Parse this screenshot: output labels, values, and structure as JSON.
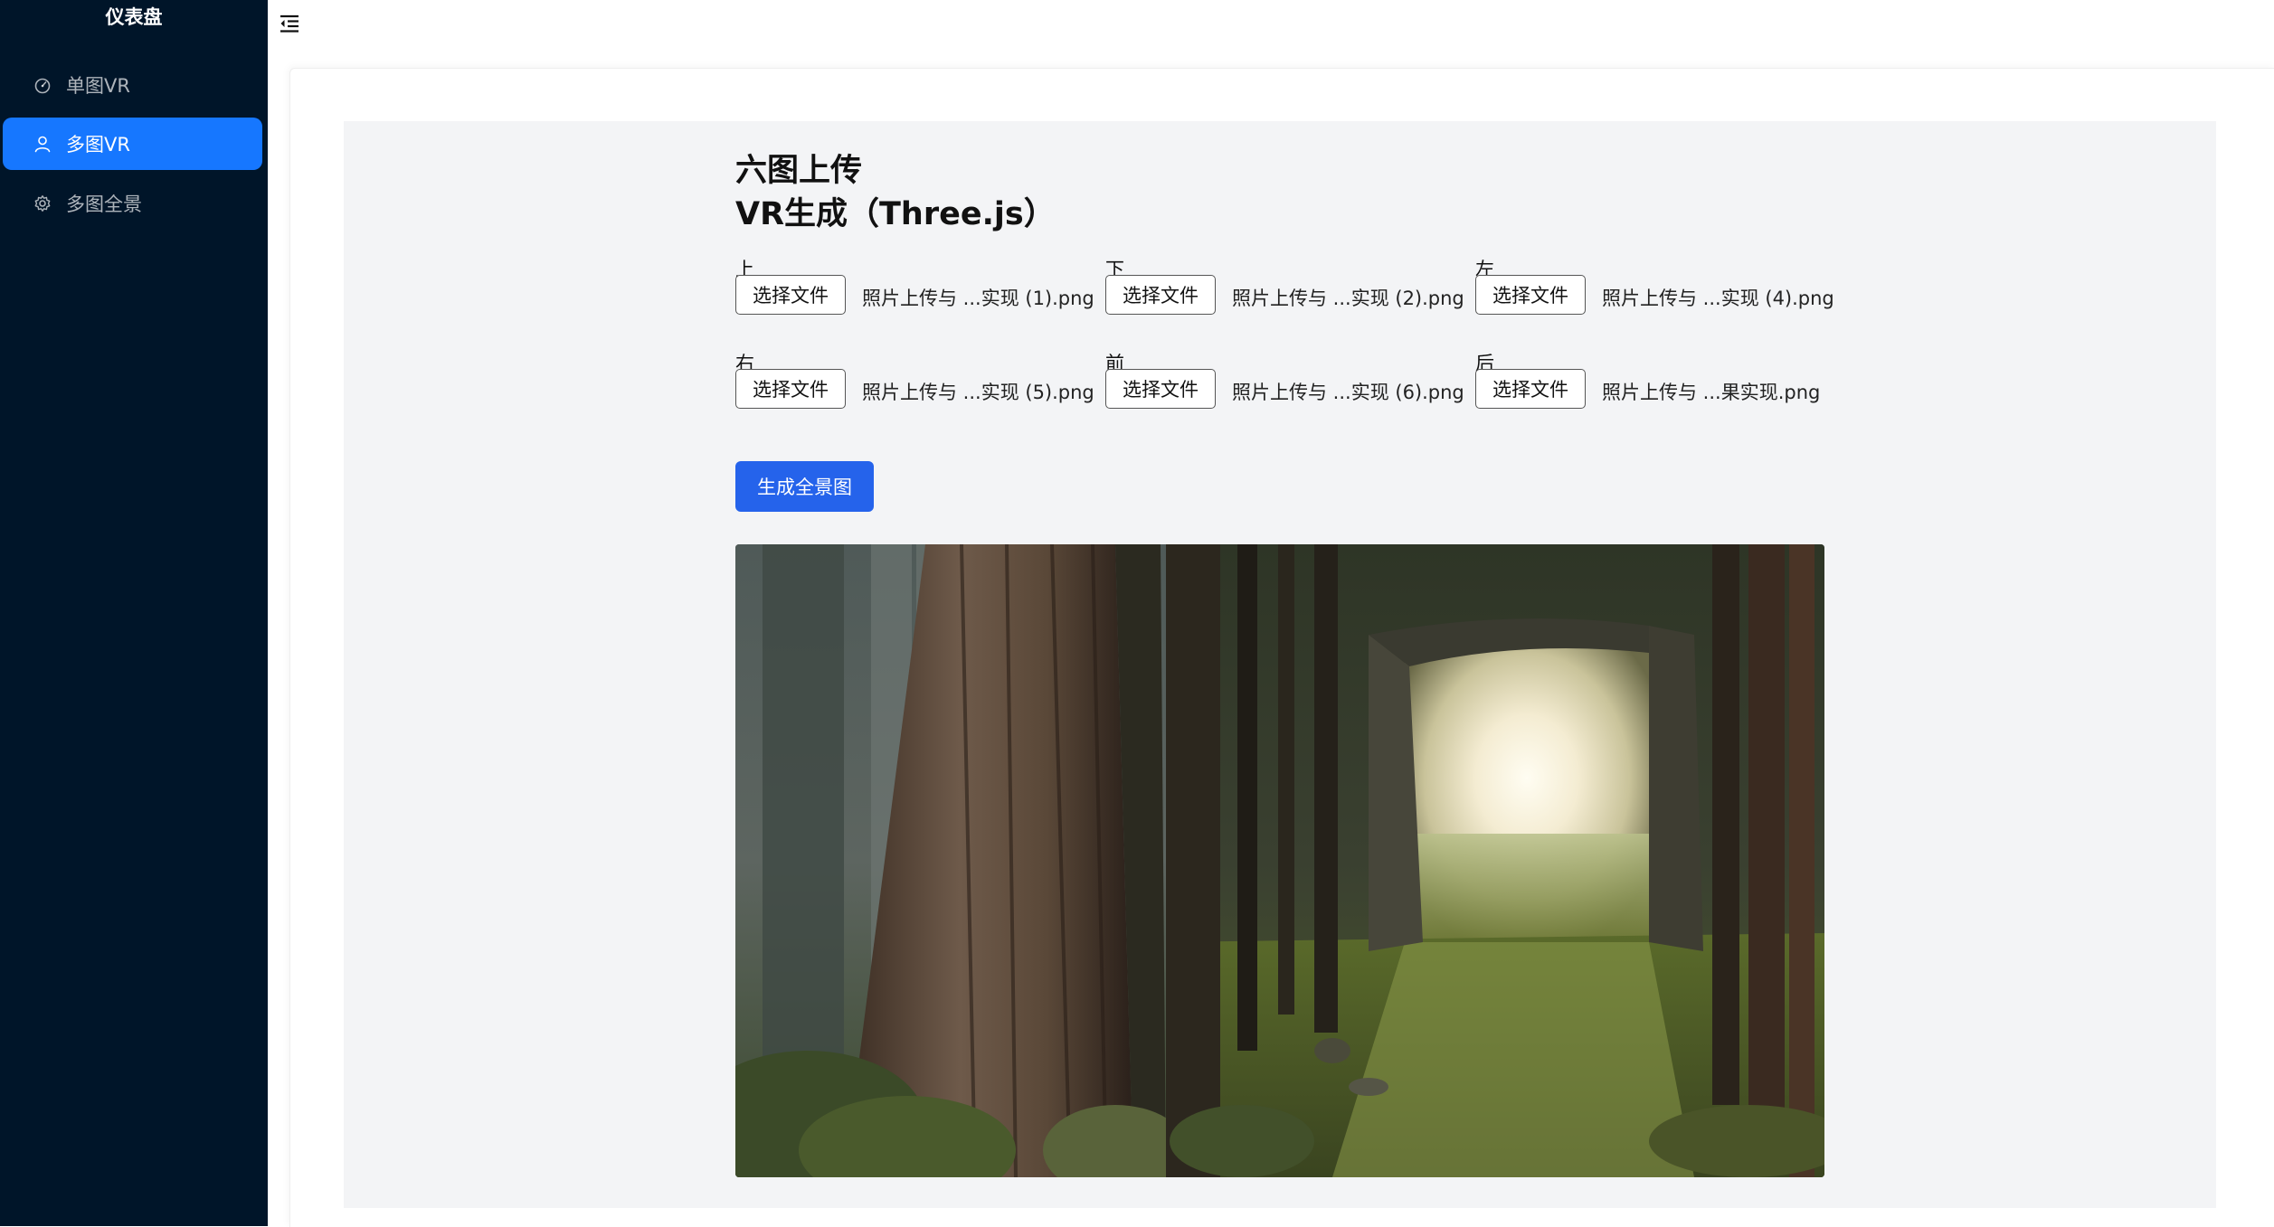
{
  "sidebar": {
    "brand": "仪表盘",
    "items": [
      {
        "label": "单图VR",
        "icon": "dashboard-icon",
        "active": false
      },
      {
        "label": "多图VR",
        "icon": "user-icon",
        "active": true
      },
      {
        "label": "多图全景",
        "icon": "gear-icon",
        "active": false
      }
    ]
  },
  "header": {
    "collapse_icon": "menu-fold-icon"
  },
  "main": {
    "title_line1": "六图上传",
    "title_line2": "VR生成（Three.js）",
    "uploads": [
      {
        "label": "上",
        "button": "选择文件",
        "filename": "照片上传与 ...实现 (1).png"
      },
      {
        "label": "下",
        "button": "选择文件",
        "filename": "照片上传与 ...实现 (2).png"
      },
      {
        "label": "左",
        "button": "选择文件",
        "filename": "照片上传与 ...实现 (4).png"
      },
      {
        "label": "右",
        "button": "选择文件",
        "filename": "照片上传与 ...实现 (5).png"
      },
      {
        "label": "前",
        "button": "选择文件",
        "filename": "照片上传与 ...实现 (6).png"
      },
      {
        "label": "后",
        "button": "选择文件",
        "filename": "照片上传与 ...果实现.png"
      }
    ],
    "generate_button": "生成全景图",
    "viewer_alt": "panorama-viewer"
  },
  "colors": {
    "sidebar_bg": "#001529",
    "active_item": "#1677ff",
    "primary_button": "#2563eb",
    "panel_bg": "#f3f4f6"
  }
}
